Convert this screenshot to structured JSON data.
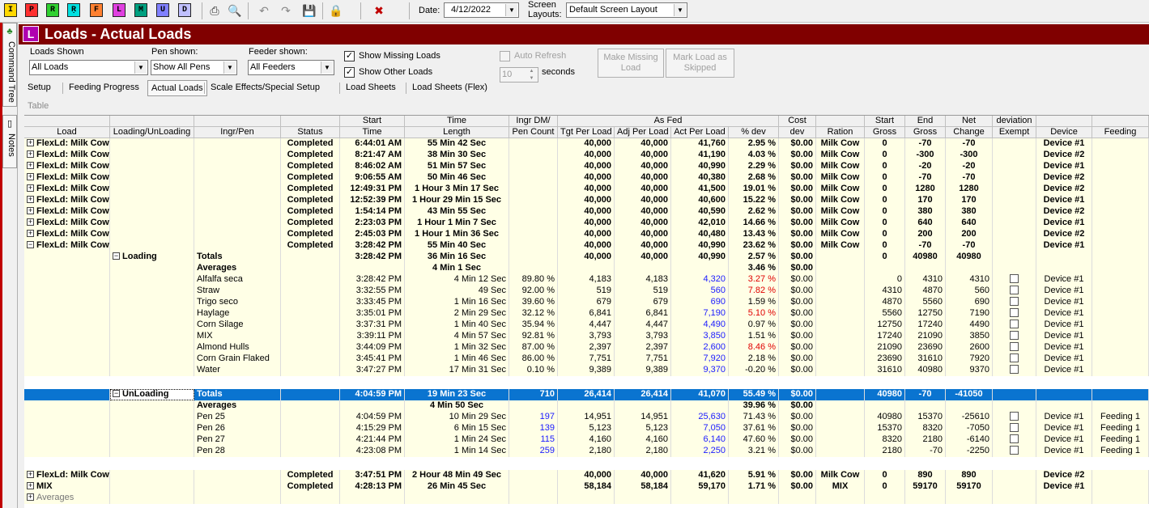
{
  "toolbar": {
    "buttons": [
      {
        "label": "I",
        "bg": "#ffd800",
        "fg": "#000"
      },
      {
        "label": "P",
        "bg": "#ff3030",
        "fg": "#000"
      },
      {
        "label": "R",
        "bg": "#30d030",
        "fg": "#000"
      },
      {
        "label": "Ṛ",
        "bg": "#00e0e0",
        "fg": "#000"
      },
      {
        "label": "F",
        "bg": "#ff8030",
        "fg": "#000"
      },
      {
        "label": "L",
        "bg": "#e040e0",
        "fg": "#000"
      },
      {
        "label": "M",
        "bg": "#00a080",
        "fg": "#000"
      },
      {
        "label": "U",
        "bg": "#8080ff",
        "fg": "#000"
      },
      {
        "label": "D",
        "bg": "#c0c0ff",
        "fg": "#000"
      }
    ],
    "icons": [
      "print-icon",
      "print-preview-icon",
      "undo-icon",
      "redo-icon",
      "save-icon",
      "lock-icon",
      "delete-icon"
    ],
    "date_label": "Date:",
    "date_value": "4/12/2022",
    "layouts_label": "Screen Layouts:",
    "layout_value": "Default Screen Layout"
  },
  "sidebar": {
    "tabs": [
      "Command Tree",
      "Notes"
    ]
  },
  "window": {
    "title": "Loads - Actual Loads",
    "icon_letter": "L",
    "title_bg": "#800000",
    "icon_bg": "#b000b0"
  },
  "filters": {
    "loads_shown_label": "Loads Shown",
    "loads_shown_value": "All Loads",
    "pen_shown_label": "Pen shown:",
    "pen_shown_value": "Show All Pens",
    "feeder_shown_label": "Feeder shown:",
    "feeder_shown_value": "All Feeders",
    "show_missing_label": "Show Missing Loads",
    "show_missing_checked": true,
    "show_other_label": "Show Other Loads",
    "show_other_checked": true,
    "auto_refresh_label": "Auto Refresh",
    "auto_refresh_checked": false,
    "refresh_seconds": "10",
    "seconds_label": "seconds",
    "make_missing_label": "Make Missing Load",
    "mark_skipped_label": "Mark Load as Skipped"
  },
  "tabs": [
    "Setup",
    "Feeding Progress",
    "Actual Loads",
    "Scale Effects/Special Setup",
    "Load Sheets",
    "Load Sheets (Flex)"
  ],
  "active_tab": "Actual Loads",
  "table_label": "Table",
  "header_top": [
    "",
    "",
    "",
    "",
    "Start",
    "Time",
    "Ingr DM/",
    "As Fed",
    "Cost",
    "",
    "Start",
    "End",
    "Net",
    "deviation",
    "",
    ""
  ],
  "header_bottom": [
    "Load",
    "Loading/UnLoading",
    "Ingr/Pen",
    "Status",
    "Time",
    "Length",
    "Pen Count",
    "Tgt Per Load",
    "Adj Per Load",
    "Act Per Load",
    "% dev",
    "dev",
    "Ration",
    "Gross",
    "Gross",
    "Change",
    "Exempt",
    "Device",
    "Feeding"
  ],
  "loads": [
    {
      "load": "FlexLd: Milk Cow",
      "status": "Completed",
      "start": "6:44:01 AM",
      "length": "55 Min 42 Sec",
      "tgt": "40,000",
      "adj": "40,000",
      "act": "41,760",
      "dev": "2.95 %",
      "cost": "$0.00",
      "ration": "Milk Cow",
      "sg": "0",
      "eg": "-70",
      "net": "-70",
      "device": "Device #1"
    },
    {
      "load": "FlexLd: Milk Cow",
      "status": "Completed",
      "start": "8:21:47 AM",
      "length": "38 Min 30 Sec",
      "tgt": "40,000",
      "adj": "40,000",
      "act": "41,190",
      "dev": "4.03 %",
      "cost": "$0.00",
      "ration": "Milk Cow",
      "sg": "0",
      "eg": "-300",
      "net": "-300",
      "device": "Device #2"
    },
    {
      "load": "FlexLd: Milk Cow",
      "status": "Completed",
      "start": "8:46:02 AM",
      "length": "51 Min 57 Sec",
      "tgt": "40,000",
      "adj": "40,000",
      "act": "40,990",
      "dev": "2.29 %",
      "cost": "$0.00",
      "ration": "Milk Cow",
      "sg": "0",
      "eg": "-20",
      "net": "-20",
      "device": "Device #1"
    },
    {
      "load": "FlexLd: Milk Cow",
      "status": "Completed",
      "start": "9:06:55 AM",
      "length": "50 Min 46 Sec",
      "tgt": "40,000",
      "adj": "40,000",
      "act": "40,380",
      "dev": "2.68 %",
      "cost": "$0.00",
      "ration": "Milk Cow",
      "sg": "0",
      "eg": "-70",
      "net": "-70",
      "device": "Device #2"
    },
    {
      "load": "FlexLd: Milk Cow",
      "status": "Completed",
      "start": "12:49:31 PM",
      "length": "1 Hour 3 Min 17 Sec",
      "tgt": "40,000",
      "adj": "40,000",
      "act": "41,500",
      "dev": "19.01 %",
      "cost": "$0.00",
      "ration": "Milk Cow",
      "sg": "0",
      "eg": "1280",
      "net": "1280",
      "device": "Device #2"
    },
    {
      "load": "FlexLd: Milk Cow",
      "status": "Completed",
      "start": "12:52:39 PM",
      "length": "1 Hour 29 Min 15 Sec",
      "tgt": "40,000",
      "adj": "40,000",
      "act": "40,600",
      "dev": "15.22 %",
      "cost": "$0.00",
      "ration": "Milk Cow",
      "sg": "0",
      "eg": "170",
      "net": "170",
      "device": "Device #1"
    },
    {
      "load": "FlexLd: Milk Cow",
      "status": "Completed",
      "start": "1:54:14 PM",
      "length": "43 Min 55 Sec",
      "tgt": "40,000",
      "adj": "40,000",
      "act": "40,590",
      "dev": "2.62 %",
      "cost": "$0.00",
      "ration": "Milk Cow",
      "sg": "0",
      "eg": "380",
      "net": "380",
      "device": "Device #2"
    },
    {
      "load": "FlexLd: Milk Cow",
      "status": "Completed",
      "start": "2:23:03 PM",
      "length": "1 Hour 1 Min 7 Sec",
      "tgt": "40,000",
      "adj": "40,000",
      "act": "42,010",
      "dev": "14.66 %",
      "cost": "$0.00",
      "ration": "Milk Cow",
      "sg": "0",
      "eg": "640",
      "net": "640",
      "device": "Device #1"
    },
    {
      "load": "FlexLd: Milk Cow",
      "status": "Completed",
      "start": "2:45:03 PM",
      "length": "1 Hour 1 Min 36 Sec",
      "tgt": "40,000",
      "adj": "40,000",
      "act": "40,480",
      "dev": "13.43 %",
      "cost": "$0.00",
      "ration": "Milk Cow",
      "sg": "0",
      "eg": "200",
      "net": "200",
      "device": "Device #2"
    },
    {
      "load": "FlexLd: Milk Cow",
      "status": "Completed",
      "start": "3:28:42 PM",
      "length": "55 Min 40 Sec",
      "tgt": "40,000",
      "adj": "40,000",
      "act": "40,990",
      "dev": "23.62 %",
      "cost": "$0.00",
      "ration": "Milk Cow",
      "sg": "0",
      "eg": "-70",
      "net": "-70",
      "device": "Device #1"
    }
  ],
  "loading": {
    "label": "Loading",
    "totals": {
      "label": "Totals",
      "start": "3:28:42 PM",
      "length": "36 Min 16 Sec",
      "tgt": "40,000",
      "adj": "40,000",
      "act": "40,990",
      "dev": "2.57 %",
      "cost": "$0.00",
      "sg": "0",
      "eg": "40980",
      "net": "40980"
    },
    "averages": {
      "label": "Averages",
      "length": "4 Min 1 Sec",
      "dev": "3.46 %",
      "cost": "$0.00"
    },
    "items": [
      {
        "name": "Alfalfa seca",
        "start": "3:28:42 PM",
        "length": "4 Min 12 Sec",
        "dm": "89.80 %",
        "tgt": "4,183",
        "adj": "4,183",
        "act": "4,320",
        "dev": "3.27 %",
        "red": true,
        "cost": "$0.00",
        "sg": "0",
        "eg": "4310",
        "net": "4310",
        "device": "Device #1"
      },
      {
        "name": "Straw",
        "start": "3:32:55 PM",
        "length": "49 Sec",
        "dm": "92.00 %",
        "tgt": "519",
        "adj": "519",
        "act": "560",
        "dev": "7.82 %",
        "red": true,
        "cost": "$0.00",
        "sg": "4310",
        "eg": "4870",
        "net": "560",
        "device": "Device #1"
      },
      {
        "name": "Trigo seco",
        "start": "3:33:45 PM",
        "length": "1 Min 16 Sec",
        "dm": "39.60 %",
        "tgt": "679",
        "adj": "679",
        "act": "690",
        "dev": "1.59 %",
        "red": false,
        "cost": "$0.00",
        "sg": "4870",
        "eg": "5560",
        "net": "690",
        "device": "Device #1"
      },
      {
        "name": "Haylage",
        "start": "3:35:01 PM",
        "length": "2 Min 29 Sec",
        "dm": "32.12 %",
        "tgt": "6,841",
        "adj": "6,841",
        "act": "7,190",
        "dev": "5.10 %",
        "red": true,
        "cost": "$0.00",
        "sg": "5560",
        "eg": "12750",
        "net": "7190",
        "device": "Device #1"
      },
      {
        "name": "Corn Silage",
        "start": "3:37:31 PM",
        "length": "1 Min 40 Sec",
        "dm": "35.94 %",
        "tgt": "4,447",
        "adj": "4,447",
        "act": "4,490",
        "dev": "0.97 %",
        "red": false,
        "cost": "$0.00",
        "sg": "12750",
        "eg": "17240",
        "net": "4490",
        "device": "Device #1"
      },
      {
        "name": "MIX",
        "start": "3:39:11 PM",
        "length": "4 Min 57 Sec",
        "dm": "92.81 %",
        "tgt": "3,793",
        "adj": "3,793",
        "act": "3,850",
        "dev": "1.51 %",
        "red": false,
        "cost": "$0.00",
        "sg": "17240",
        "eg": "21090",
        "net": "3850",
        "device": "Device #1"
      },
      {
        "name": "Almond Hulls",
        "start": "3:44:09 PM",
        "length": "1 Min 32 Sec",
        "dm": "87.00 %",
        "tgt": "2,397",
        "adj": "2,397",
        "act": "2,600",
        "dev": "8.46 %",
        "red": true,
        "cost": "$0.00",
        "sg": "21090",
        "eg": "23690",
        "net": "2600",
        "device": "Device #1"
      },
      {
        "name": "Corn Grain Flaked",
        "start": "3:45:41 PM",
        "length": "1 Min 46 Sec",
        "dm": "86.00 %",
        "tgt": "7,751",
        "adj": "7,751",
        "act": "7,920",
        "dev": "2.18 %",
        "red": false,
        "cost": "$0.00",
        "sg": "23690",
        "eg": "31610",
        "net": "7920",
        "device": "Device #1"
      },
      {
        "name": "Water",
        "start": "3:47:27 PM",
        "length": "17 Min 31 Sec",
        "dm": "0.10 %",
        "tgt": "9,389",
        "adj": "9,389",
        "act": "9,370",
        "dev": "-0.20 %",
        "red": false,
        "cost": "$0.00",
        "sg": "31610",
        "eg": "40980",
        "net": "9370",
        "device": "Device #1"
      }
    ]
  },
  "unloading": {
    "label": "UnLoading",
    "totals": {
      "label": "Totals",
      "start": "4:04:59 PM",
      "length": "19 Min 23 Sec",
      "dm": "710",
      "tgt": "26,414",
      "adj": "26,414",
      "act": "41,070",
      "dev": "55.49 %",
      "cost": "$0.00",
      "sg": "40980",
      "eg": "-70",
      "net": "-41050"
    },
    "averages": {
      "label": "Averages",
      "length": "4 Min 50 Sec",
      "dev": "39.96 %",
      "cost": "$0.00"
    },
    "items": [
      {
        "name": "Pen 25",
        "start": "4:04:59 PM",
        "length": "10 Min 29 Sec",
        "dm": "197",
        "tgt": "14,951",
        "adj": "14,951",
        "act": "25,630",
        "dev": "71.43 %",
        "cost": "$0.00",
        "sg": "40980",
        "eg": "15370",
        "net": "-25610",
        "device": "Device #1",
        "feeding": "Feeding 1"
      },
      {
        "name": "Pen 26",
        "start": "4:15:29 PM",
        "length": "6 Min 15 Sec",
        "dm": "139",
        "tgt": "5,123",
        "adj": "5,123",
        "act": "7,050",
        "dev": "37.61 %",
        "cost": "$0.00",
        "sg": "15370",
        "eg": "8320",
        "net": "-7050",
        "device": "Device #1",
        "feeding": "Feeding 1"
      },
      {
        "name": "Pen 27",
        "start": "4:21:44 PM",
        "length": "1 Min 24 Sec",
        "dm": "115",
        "tgt": "4,160",
        "adj": "4,160",
        "act": "6,140",
        "dev": "47.60 %",
        "cost": "$0.00",
        "sg": "8320",
        "eg": "2180",
        "net": "-6140",
        "device": "Device #1",
        "feeding": "Feeding 1"
      },
      {
        "name": "Pen 28",
        "start": "4:23:08 PM",
        "length": "1 Min 14 Sec",
        "dm": "259",
        "tgt": "2,180",
        "adj": "2,180",
        "act": "2,250",
        "dev": "3.21 %",
        "cost": "$0.00",
        "sg": "2180",
        "eg": "-70",
        "net": "-2250",
        "device": "Device #1",
        "feeding": "Feeding 1"
      }
    ]
  },
  "tail_loads": [
    {
      "load": "FlexLd: Milk Cow",
      "status": "Completed",
      "start": "3:47:51 PM",
      "length": "2 Hour 48 Min 49 Sec",
      "tgt": "40,000",
      "adj": "40,000",
      "act": "41,620",
      "dev": "5.91 %",
      "cost": "$0.00",
      "ration": "Milk Cow",
      "sg": "0",
      "eg": "890",
      "net": "890",
      "device": "Device #2"
    },
    {
      "load": "MIX",
      "status": "Completed",
      "start": "4:28:13 PM",
      "length": "26 Min 45 Sec",
      "tgt": "58,184",
      "adj": "58,184",
      "act": "59,170",
      "dev": "1.71 %",
      "cost": "$0.00",
      "ration": "MIX",
      "sg": "0",
      "eg": "59170",
      "net": "59170",
      "device": "Device #1"
    }
  ],
  "footer_averages": "Averages"
}
